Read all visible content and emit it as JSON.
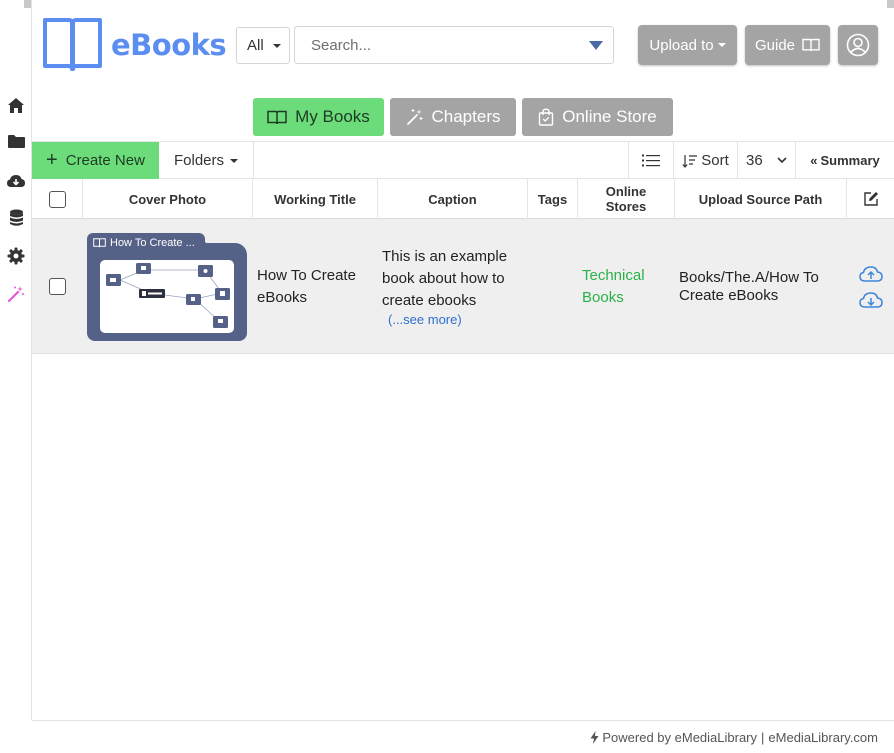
{
  "app": {
    "name": "eBooks"
  },
  "header": {
    "scope_value": "All",
    "search_placeholder": "Search...",
    "upload_label": "Upload to",
    "guide_label": "Guide"
  },
  "tabs": [
    {
      "label": "My Books",
      "active": true,
      "color": "#6cdc7a"
    },
    {
      "label": "Chapters",
      "active": false,
      "color": "#a4a4a4"
    },
    {
      "label": "Online Store",
      "active": false,
      "color": "#a4a4a4"
    }
  ],
  "toolbar": {
    "create_label": "Create New",
    "folders_label": "Folders",
    "sort_label": "Sort",
    "page_size": "36",
    "summary_label": "Summary"
  },
  "table": {
    "columns": {
      "cover": "Cover Photo",
      "title": "Working Title",
      "caption": "Caption",
      "tags": "Tags",
      "stores": "Online Stores",
      "path": "Upload Source Path"
    },
    "rows": [
      {
        "cover_label": "How To Create ...",
        "title": "How To Create eBooks",
        "caption": "This is an example book about how to create ebooks",
        "see_more": "(...see more)",
        "tags": "",
        "store": "Technical Books",
        "path": "Books/The.A/How To Create eBooks"
      }
    ]
  },
  "footer": {
    "powered": "Powered by eMediaLibrary",
    "separator": "|",
    "site": "eMediaLibrary.com"
  },
  "colors": {
    "brand_blue": "#5b8ef0",
    "active_green": "#6cdc7a",
    "button_gray": "#a4a4a4",
    "store_green": "#2bb24a",
    "cover_slate": "#566187"
  }
}
